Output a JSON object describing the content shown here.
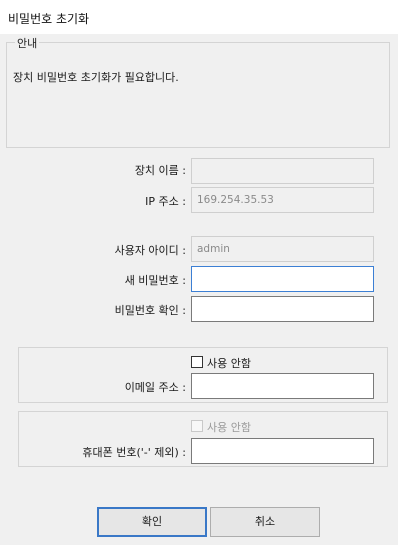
{
  "window": {
    "title": "비밀번호 초기화"
  },
  "notice": {
    "legend": "안내",
    "text": "장치 비밀번호 초기화가 필요합니다."
  },
  "device": {
    "name_label": "장치 이름 :",
    "name_value": "",
    "ip_label": "IP 주소 :",
    "ip_value": "169.254.35.53"
  },
  "account": {
    "user_id_label": "사용자 아이디 :",
    "user_id_value": "admin",
    "new_password_label": "새 비밀번호 :",
    "new_password_value": "",
    "confirm_password_label": "비밀번호 확인 :",
    "confirm_password_value": ""
  },
  "email": {
    "checkbox_label": "사용 안함",
    "checked": false,
    "label": "이메일 주소 :",
    "value": ""
  },
  "phone": {
    "checkbox_label": "사용 안함",
    "checked": false,
    "disabled": true,
    "label": "휴대폰 번호('-' 제외) :",
    "value": ""
  },
  "buttons": {
    "ok": "확인",
    "cancel": "취소"
  }
}
